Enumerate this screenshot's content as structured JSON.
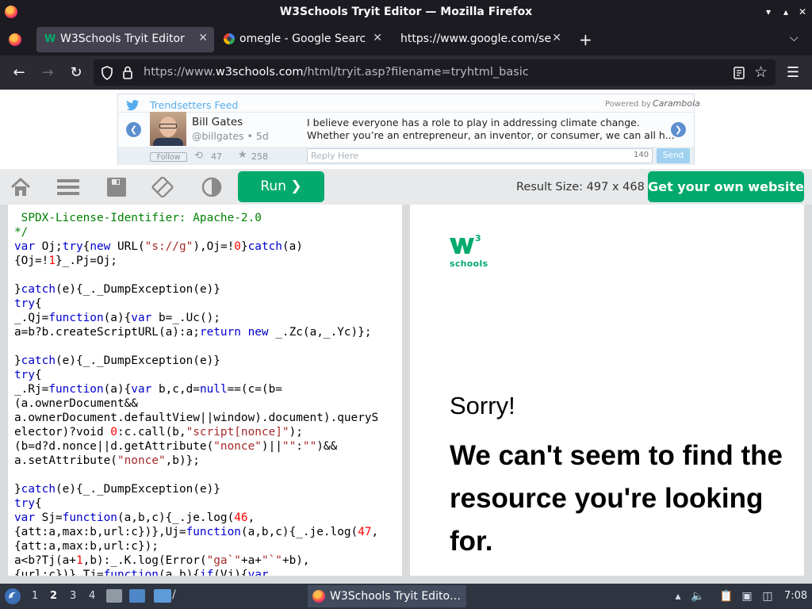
{
  "window": {
    "title": "W3Schools Tryit Editor — Mozilla Firefox"
  },
  "tabs": [
    {
      "label": "W3Schools Tryit Editor",
      "active": true,
      "icon": "w3schools-favicon"
    },
    {
      "label": "omegle - Google Search",
      "active": false,
      "icon": "google-favicon"
    },
    {
      "label": "https://www.google.com/sea",
      "active": false,
      "icon": "none"
    }
  ],
  "urlbar": {
    "prefix": "https://www.",
    "host": "w3schools.com",
    "path": "/html/tryit.asp?filename=tryhtml_basic"
  },
  "ad": {
    "feed_title": "Trendsetters Feed",
    "powered_by": "Powered by",
    "powered_brand": "Carambola",
    "user_name": "Bill Gates",
    "user_handle": "@billgates • 5d",
    "tweet_line1": "I believe everyone has a role to play in addressing climate change.",
    "tweet_line2": "Whether you’re an entrepreneur, an inventor, or consumer, we can all h...",
    "follow_label": "Follow",
    "retweets": "47",
    "likes": "258",
    "reply_placeholder": "Reply Here",
    "char_count": "140",
    "send_label": "Send"
  },
  "toolbar": {
    "run_label": "Run ❯",
    "result_size": "Result Size: 497 x 468",
    "get_website_label": "Get your own website"
  },
  "code_lines": [
    [
      [
        "c",
        " SPDX-License-Identifier: Apache-2.0"
      ]
    ],
    [
      [
        "c",
        "*/"
      ]
    ],
    [
      [
        "k",
        "var"
      ],
      [
        "t",
        " Oj;"
      ],
      [
        "k",
        "try"
      ],
      [
        "t",
        "{"
      ],
      [
        "k",
        "new"
      ],
      [
        "t",
        " URL("
      ],
      [
        "s",
        "\"s://g\""
      ],
      [
        "t",
        "),Oj=!"
      ],
      [
        "n",
        "0"
      ],
      [
        "t",
        "}"
      ],
      [
        "k",
        "catch"
      ],
      [
        "t",
        "(a)"
      ]
    ],
    [
      [
        "t",
        "{Oj=!"
      ],
      [
        "n",
        "1"
      ],
      [
        "t",
        "}_.Pj=Oj;"
      ]
    ],
    [
      [
        "t",
        ""
      ]
    ],
    [
      [
        "t",
        "}"
      ],
      [
        "k",
        "catch"
      ],
      [
        "t",
        "(e){_._DumpException(e)}"
      ]
    ],
    [
      [
        "k",
        "try"
      ],
      [
        "t",
        "{"
      ]
    ],
    [
      [
        "t",
        "_.Qj="
      ],
      [
        "k",
        "function"
      ],
      [
        "t",
        "(a){"
      ],
      [
        "k",
        "var"
      ],
      [
        "t",
        " b=_.Uc();"
      ]
    ],
    [
      [
        "t",
        "a=b?b.createScriptURL(a):a;"
      ],
      [
        "k",
        "return"
      ],
      [
        "t",
        " "
      ],
      [
        "k",
        "new"
      ],
      [
        "t",
        " _.Zc(a,_.Yc)};"
      ]
    ],
    [
      [
        "t",
        ""
      ]
    ],
    [
      [
        "t",
        "}"
      ],
      [
        "k",
        "catch"
      ],
      [
        "t",
        "(e){_._DumpException(e)}"
      ]
    ],
    [
      [
        "k",
        "try"
      ],
      [
        "t",
        "{"
      ]
    ],
    [
      [
        "t",
        "_.Rj="
      ],
      [
        "k",
        "function"
      ],
      [
        "t",
        "(a){"
      ],
      [
        "k",
        "var"
      ],
      [
        "t",
        " b,c,d="
      ],
      [
        "k",
        "null"
      ],
      [
        "t",
        "==(c=(b="
      ]
    ],
    [
      [
        "t",
        "(a.ownerDocument&&"
      ]
    ],
    [
      [
        "t",
        "a.ownerDocument.defaultView||window).document).queryS"
      ]
    ],
    [
      [
        "t",
        "elector)?void "
      ],
      [
        "n",
        "0"
      ],
      [
        "t",
        ":c.call(b,"
      ],
      [
        "s",
        "\"script[nonce]\""
      ],
      [
        "t",
        ");"
      ]
    ],
    [
      [
        "t",
        "(b=d?d.nonce||d.getAttribute("
      ],
      [
        "s",
        "\"nonce\""
      ],
      [
        "t",
        ")||"
      ],
      [
        "s",
        "\"\""
      ],
      [
        "t",
        ":"
      ],
      [
        "s",
        "\"\""
      ],
      [
        "t",
        ")&&"
      ]
    ],
    [
      [
        "t",
        "a.setAttribute("
      ],
      [
        "s",
        "\"nonce\""
      ],
      [
        "t",
        ",b)};"
      ]
    ],
    [
      [
        "t",
        ""
      ]
    ],
    [
      [
        "t",
        "}"
      ],
      [
        "k",
        "catch"
      ],
      [
        "t",
        "(e){_._DumpException(e)}"
      ]
    ],
    [
      [
        "k",
        "try"
      ],
      [
        "t",
        "{"
      ]
    ],
    [
      [
        "k",
        "var"
      ],
      [
        "t",
        " Sj="
      ],
      [
        "k",
        "function"
      ],
      [
        "t",
        "(a,b,c){_.je.log("
      ],
      [
        "n",
        "46"
      ],
      [
        "t",
        ","
      ]
    ],
    [
      [
        "t",
        "{att:a,max:b,url:c})},Uj="
      ],
      [
        "k",
        "function"
      ],
      [
        "t",
        "(a,b,c){_.je.log("
      ],
      [
        "n",
        "47"
      ],
      [
        "t",
        ","
      ]
    ],
    [
      [
        "t",
        "{att:a,max:b,url:c});"
      ]
    ],
    [
      [
        "t",
        "a<b?Tj(a+"
      ],
      [
        "n",
        "1"
      ],
      [
        "t",
        ",b):_.K.log(Error("
      ],
      [
        "s",
        "\"ga`\""
      ],
      [
        "t",
        "+a+"
      ],
      [
        "s",
        "\"`\""
      ],
      [
        "t",
        "+b),"
      ]
    ],
    [
      [
        "t",
        "{url:c})},Tj="
      ],
      [
        "k",
        "function"
      ],
      [
        "t",
        "(a,b){"
      ],
      [
        "k",
        "if"
      ],
      [
        "t",
        "(Vj){"
      ],
      [
        "k",
        "var"
      ]
    ]
  ],
  "result": {
    "logo_text": "schools",
    "logo_sup": "3",
    "sorry": "Sorry!",
    "message": "We can't seem to find the resource you're looking for."
  },
  "taskbar": {
    "workspaces": [
      "1",
      "2",
      "3",
      "4"
    ],
    "current_workspace": "2",
    "task_label": "W3Schools Tryit Edito…",
    "clock": "7:08"
  },
  "colors": {
    "accent": "#04aa6d",
    "chrome_dark": "#1c1b22",
    "chrome_mid": "#2b2a33"
  }
}
